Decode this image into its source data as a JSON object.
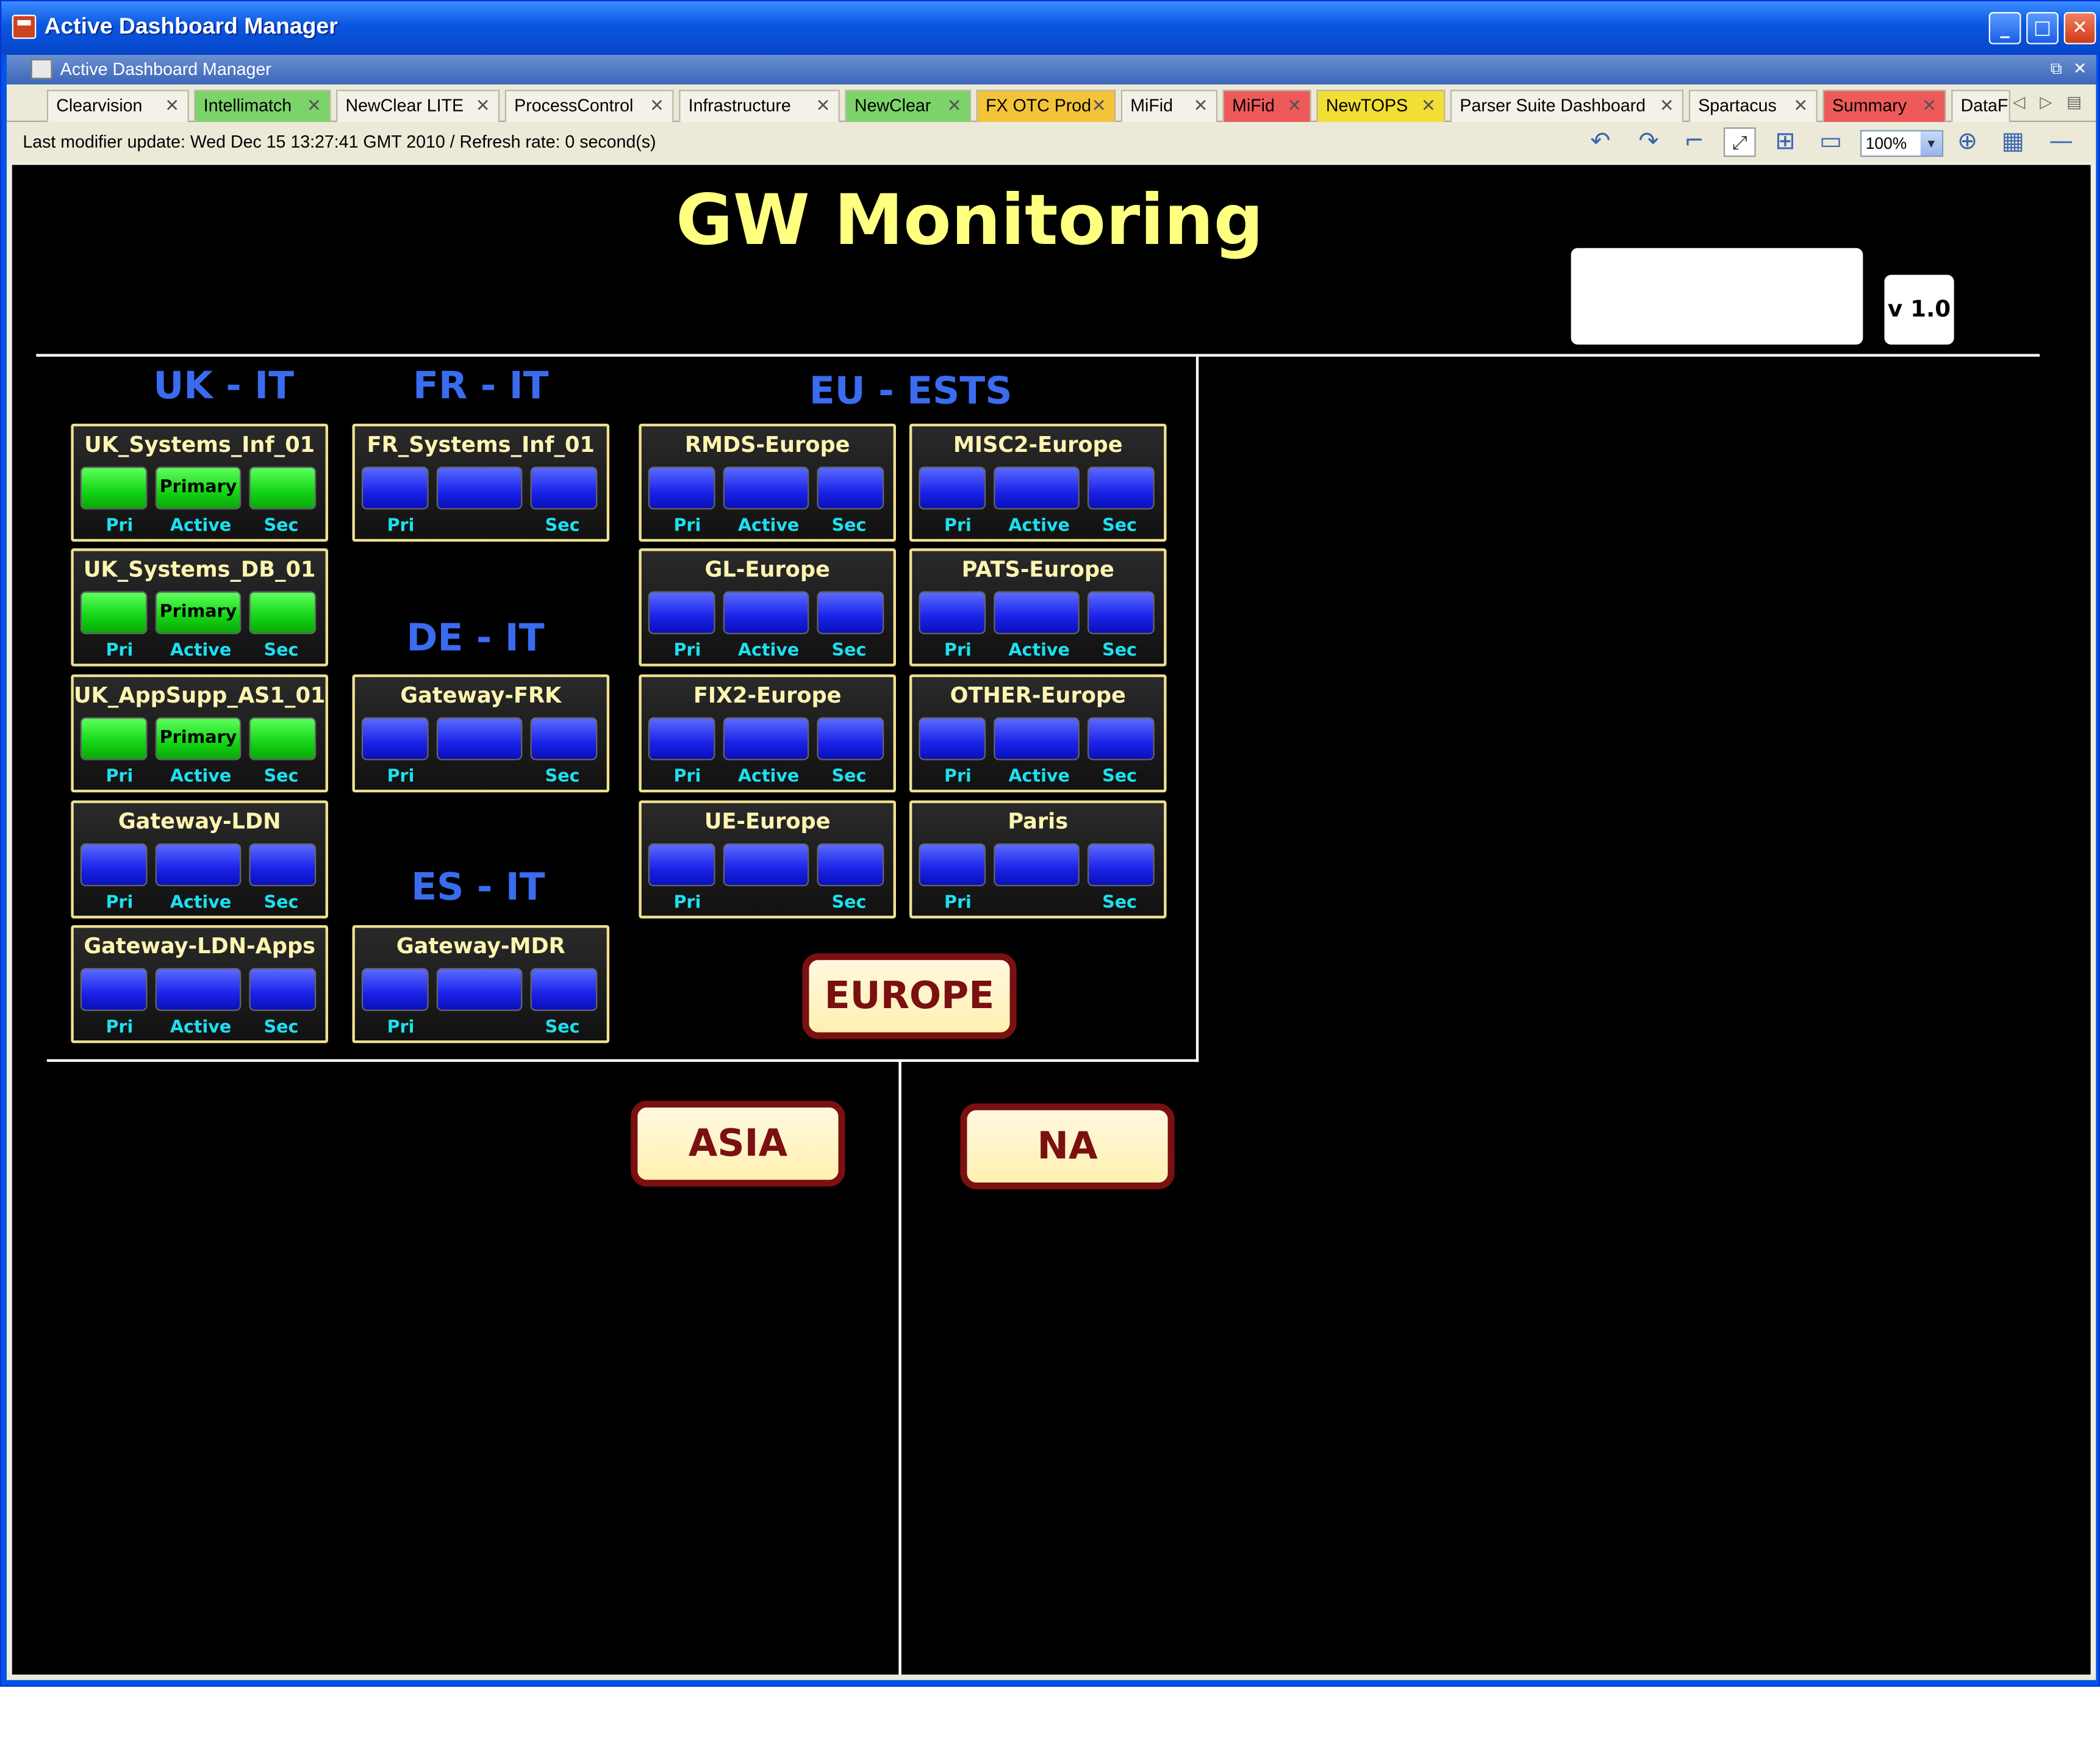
{
  "window": {
    "title": "Active Dashboard Manager",
    "minimize": "_",
    "maximize": "□",
    "close": "✕"
  },
  "subwindow": {
    "title": "Active Dashboard Manager",
    "ctl_restore": "⧉",
    "ctl_close": "✕"
  },
  "tabs": [
    {
      "label": "Clearvision",
      "color": "default"
    },
    {
      "label": "Intellimatch",
      "color": "#7cd36a"
    },
    {
      "label": "NewClear LITE",
      "color": "default"
    },
    {
      "label": "ProcessControl",
      "color": "default"
    },
    {
      "label": "Infrastructure",
      "color": "default"
    },
    {
      "label": "NewClear",
      "color": "#7cd36a"
    },
    {
      "label": "FX OTC Prod",
      "color": "#f3c43a"
    },
    {
      "label": "MiFid",
      "color": "default"
    },
    {
      "label": "MiFid",
      "color": "#ee5a5a"
    },
    {
      "label": "NewTOPS",
      "color": "#f2df35"
    },
    {
      "label": "Parser Suite Dashboard",
      "color": "default"
    },
    {
      "label": "Spartacus",
      "color": "default"
    },
    {
      "label": "Summary",
      "color": "#ee5a5a"
    },
    {
      "label": "DataF",
      "color": "default"
    }
  ],
  "tab_close": "✕",
  "tab_nav": {
    "prev": "◁",
    "next": "▷",
    "menu": "▤"
  },
  "toolbar": {
    "status": "Last modifier update: Wed Dec 15 13:27:41 GMT 2010 / Refresh rate: 0 second(s)",
    "zoom": "100%",
    "zoom_arrow": "▼"
  },
  "dashboard": {
    "title": "GW Monitoring",
    "version": "v 1.0",
    "regions": {
      "uk": "UK - IT",
      "fr": "FR - IT",
      "de": "DE - IT",
      "es": "ES - IT",
      "eu": "EU - ESTS"
    },
    "labels": {
      "pri": "Pri",
      "active": "Active",
      "sec": "Sec",
      "primary": "Primary"
    },
    "panels": [
      {
        "name": "UK_Systems_Inf_01",
        "state": "green",
        "middle": "Primary",
        "show_active": true
      },
      {
        "name": "UK_Systems_DB_01",
        "state": "green",
        "middle": "Primary",
        "show_active": true
      },
      {
        "name": "UK_AppSupp_AS1_01",
        "state": "green",
        "middle": "Primary",
        "show_active": true
      },
      {
        "name": "Gateway-LDN",
        "state": "blue",
        "middle": "",
        "show_active": true
      },
      {
        "name": "Gateway-LDN-Apps",
        "state": "blue",
        "middle": "",
        "show_active": true
      },
      {
        "name": "FR_Systems_Inf_01",
        "state": "blue",
        "middle": "",
        "show_active": false
      },
      {
        "name": "Gateway-FRK",
        "state": "blue",
        "middle": "",
        "show_active": false
      },
      {
        "name": "Gateway-MDR",
        "state": "blue",
        "middle": "",
        "show_active": false
      },
      {
        "name": "RMDS-Europe",
        "state": "blue",
        "middle": "",
        "show_active": true
      },
      {
        "name": "MISC2-Europe",
        "state": "blue",
        "middle": "",
        "show_active": true
      },
      {
        "name": "GL-Europe",
        "state": "blue",
        "middle": "",
        "show_active": true
      },
      {
        "name": "PATS-Europe",
        "state": "blue",
        "middle": "",
        "show_active": true
      },
      {
        "name": "FIX2-Europe",
        "state": "blue",
        "middle": "",
        "show_active": true
      },
      {
        "name": "OTHER-Europe",
        "state": "blue",
        "middle": "",
        "show_active": true
      },
      {
        "name": "UE-Europe",
        "state": "blue",
        "middle": "",
        "show_active": false
      },
      {
        "name": "Paris",
        "state": "blue",
        "middle": "",
        "show_active": false
      }
    ],
    "buttons": {
      "europe": "EUROPE",
      "asia": "ASIA",
      "na": "NA"
    }
  },
  "colors": {
    "green": "#14d414",
    "blue": "#1a22e8",
    "title_yellow": "#ffff80",
    "region_blue": "#3a6cf0",
    "label_cyan": "#1ce0f0",
    "button_border": "#7a1010"
  }
}
